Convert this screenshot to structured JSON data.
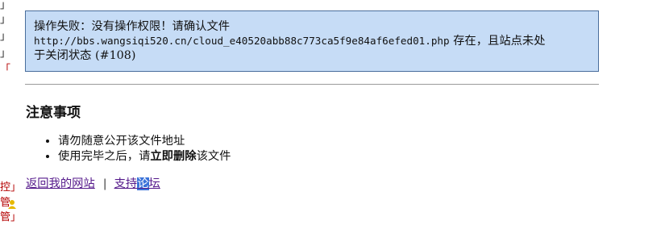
{
  "left_edge": {
    "fragments": [
      "」",
      "」",
      "」",
      "」",
      "控」",
      "管」"
    ]
  },
  "error": {
    "line1": "操作失败：没有操作权限！请确认文件",
    "url": "http://bbs.wangsiqi520.cn/cloud_e40520abb88c773ca5f9e84af6efed01.php",
    "line2_tail": " 存在，且站点未处",
    "line3": "于关闭状态 (#108)"
  },
  "notes": {
    "title": "注意事项",
    "items": [
      {
        "text": "请勿随意公开该文件地址"
      },
      {
        "prefix": "使用完毕之后，请",
        "bold": "立即删除",
        "suffix": "该文件"
      }
    ]
  },
  "footer": {
    "return_link": "返回我的网站",
    "separator": "|",
    "support_part1": "支持",
    "support_highlight": "论",
    "support_part2": "坛"
  },
  "colors": {
    "box_bg": "#c6dcf6",
    "box_border": "#4a6e9c",
    "link": "#551a8b",
    "selection": "#3b73d9"
  }
}
